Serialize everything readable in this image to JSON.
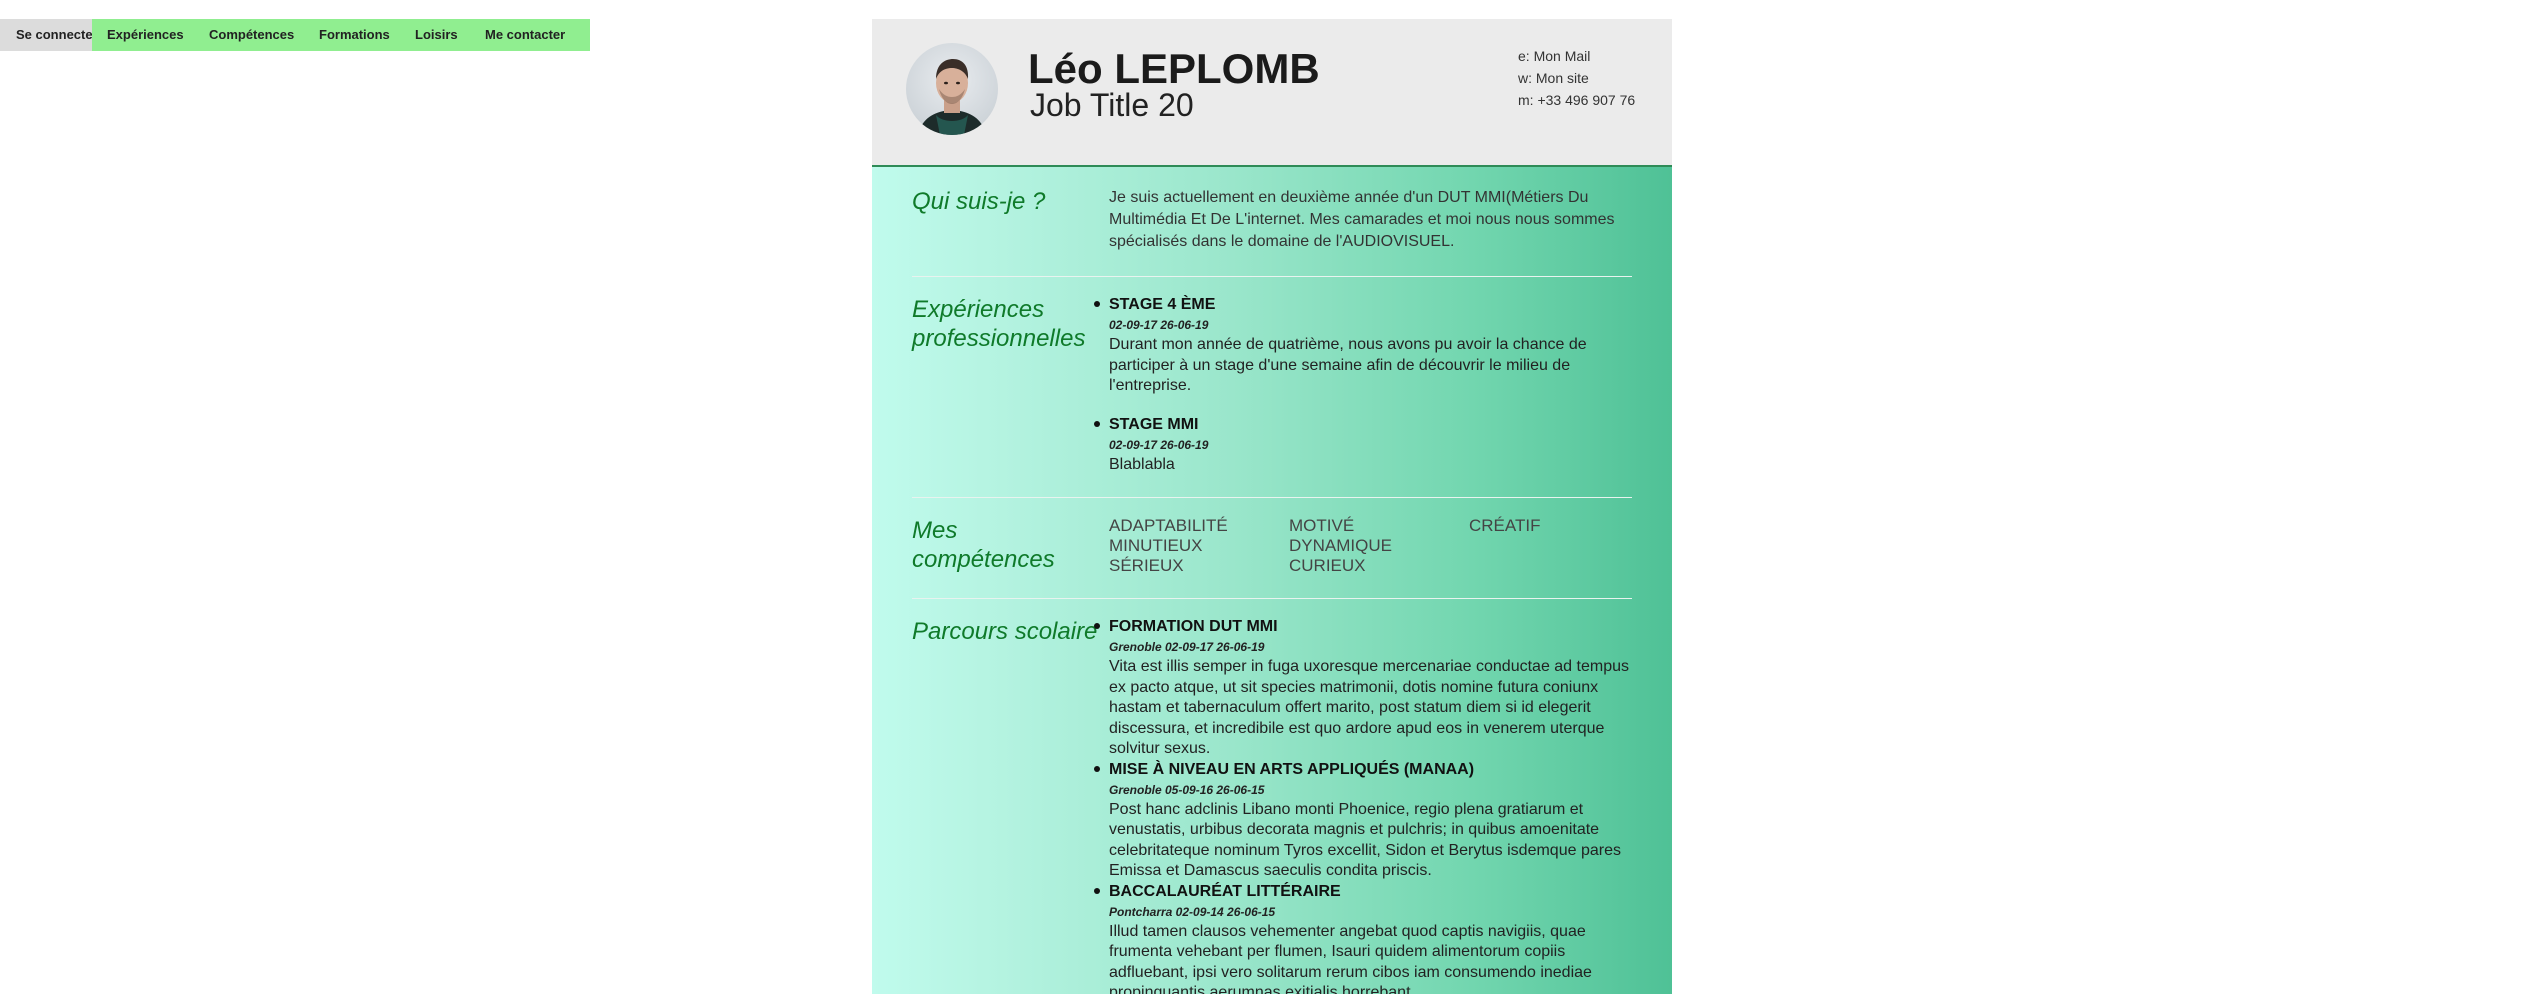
{
  "nav": {
    "items": [
      {
        "label": "Se connecter"
      },
      {
        "label": "Expériences"
      },
      {
        "label": "Compétences"
      },
      {
        "label": "Formations"
      },
      {
        "label": "Loisirs"
      },
      {
        "label": "Me contacter"
      }
    ]
  },
  "colors": {
    "nav_active": "#dcdcdc",
    "nav_bg": "#90ee90",
    "section_title": "#0f7a2a",
    "header_bg": "#ebebeb"
  },
  "header": {
    "name": "Léo LEPLOMB",
    "job_title": "Job Title 20",
    "contacts": {
      "mail": "e: Mon Mail",
      "site": "w: Mon site",
      "phone": "m: +33 496 907 76"
    }
  },
  "about": {
    "title": "Qui suis-je ?",
    "text": "Je suis actuellement en deuxième année d'un DUT MMI(Métiers Du Multimédia Et De L'internet. Mes camarades et moi nous nous sommes spécialisés dans le domaine de l'AUDIOVISUEL."
  },
  "experiences": {
    "title": "Expériences professionnelles",
    "items": [
      {
        "title": "STAGE 4 ÈME",
        "dates": "02-09-17 26-06-19",
        "text": "Durant mon année de quatrième, nous avons pu avoir la chance de participer à un stage d'une semaine afin de découvrir le milieu de l'entreprise."
      },
      {
        "title": "STAGE MMI",
        "dates": "02-09-17 26-06-19",
        "text": "Blablabla"
      }
    ]
  },
  "skills": {
    "title": "Mes compétences",
    "items": [
      "ADAPTABILITÉ",
      "MOTIVÉ",
      "CRÉATIF",
      "MINUTIEUX",
      "DYNAMIQUE",
      "SÉRIEUX",
      "CURIEUX"
    ]
  },
  "education": {
    "title": "Parcours scolaire",
    "items": [
      {
        "title": "FORMATION DUT MMI",
        "dates": "Grenoble 02-09-17 26-06-19",
        "text": "Vita est illis semper in fuga uxoresque mercenariae conductae ad tempus ex pacto atque, ut sit species matrimonii, dotis nomine futura coniunx hastam et tabernaculum offert marito, post statum diem si id elegerit discessura, et incredibile est quo ardore apud eos in venerem uterque solvitur sexus."
      },
      {
        "title": "MISE À NIVEAU EN ARTS APPLIQUÉS (MANAA)",
        "dates": "Grenoble 05-09-16 26-06-15",
        "text": "Post hanc adclinis Libano monti Phoenice, regio plena gratiarum et venustatis, urbibus decorata magnis et pulchris; in quibus amoenitate celebritateque nominum Tyros excellit, Sidon et Berytus isdemque pares Emissa et Damascus saeculis condita priscis."
      },
      {
        "title": "BACCALAURÉAT LITTÉRAIRE",
        "dates": "Pontcharra 02-09-14 26-06-15",
        "text": "Illud tamen clausos vehementer angebat quod captis navigiis, quae frumenta vehebant per flumen, Isauri quidem alimentorum copiis adfluebant, ipsi vero solitarum rerum cibos iam consumendo inediae propinquantis aerumnas exitialis horrebant."
      }
    ]
  }
}
